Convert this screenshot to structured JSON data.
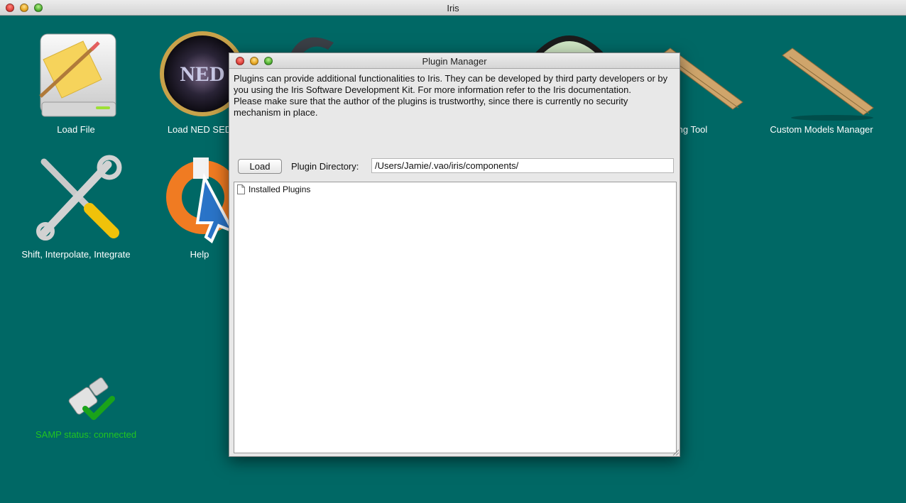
{
  "window": {
    "title": "Iris"
  },
  "desktop": {
    "icons": [
      {
        "label": "Load File",
        "icon": "load-file-icon"
      },
      {
        "label": "Load NED SED",
        "icon": "ned-icon"
      },
      {
        "label": "Fitting Tool",
        "icon": "fitting-tool-icon"
      },
      {
        "label": "Custom Models Manager",
        "icon": "ruler-icon"
      },
      {
        "label": "Shift, Interpolate, Integrate",
        "icon": "tools-icon"
      },
      {
        "label": "Help",
        "icon": "help-lifebuoy-icon"
      }
    ],
    "samp_status": "SAMP status: connected",
    "samp_color": "#21c421"
  },
  "dialog": {
    "title": "Plugin Manager",
    "description_1": "Plugins can provide additional functionalities to Iris. They can be developed by third party developers or by you using the Iris Software Development Kit. For more information refer to the Iris documentation.",
    "description_2": "Please make sure that the author of the plugins is trustworthy, since there is currently no security mechanism in place.",
    "load_label": "Load",
    "dir_label": "Plugin Directory:",
    "dir_value": "/Users/Jamie/.vao/iris/components/",
    "tree_root": "Installed Plugins"
  },
  "colors": {
    "desktop_bg": "#006865",
    "dialog_bg": "#e8e8e8"
  }
}
